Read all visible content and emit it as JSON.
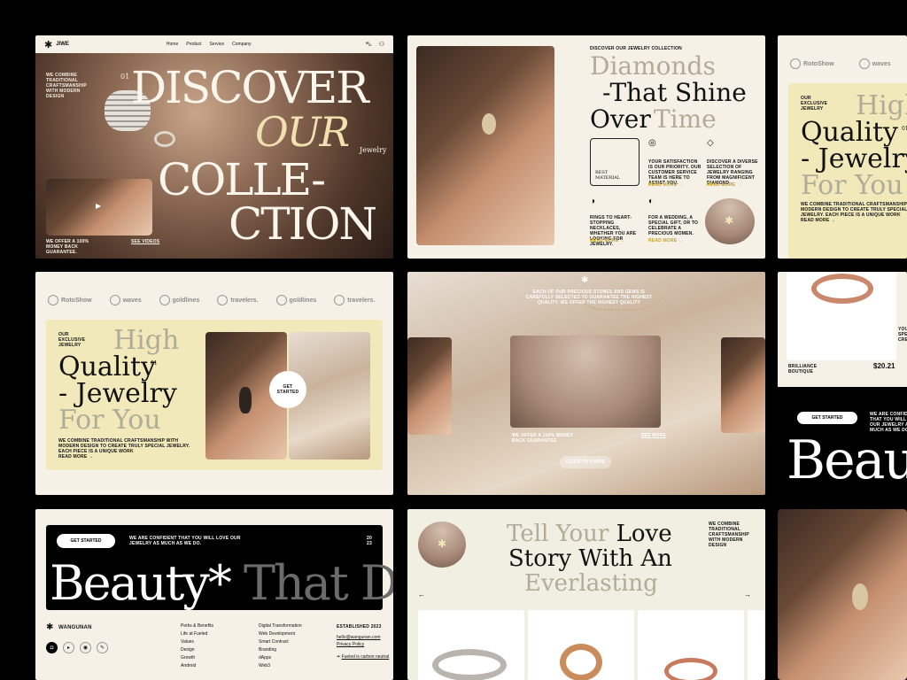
{
  "card1": {
    "brand": "JIWE",
    "nav": [
      "Home",
      "Product",
      "Service",
      "Company"
    ],
    "num": "01",
    "title_1": "DISCOVER",
    "title_2": "OUR",
    "title_3": "COLLE-",
    "title_4": "CTION",
    "subtitle": "Jewelry",
    "intro": "WE COMBINE TRADITIONAL CRAFTSMANSHIP WITH MODERN DESIGN",
    "guarantee": "WE OFFER A 100% MONEY BACK GUARANTEE.",
    "see_videos": "SEE VIDEOS"
  },
  "card2": {
    "eyebrow": "DISCOVER OUR JEWELRY COLLECTION",
    "h1": "Diamonds",
    "h2": "-That Shine",
    "h3a": "Over",
    "h3b": "Time",
    "badge": "BEST MATERIAL",
    "feat1": "YOUR SATISFACTION IS OUR PRIORITY. OUR CUSTOMER SERVICE TEAM IS HERE TO ASSIST YOU.",
    "feat2": "DISCOVER A DIVERSE SELECTION OF JEWELRY RANGING FROM MAGNIFICENT DIAMOND .",
    "feat3": "RINGS TO HEART-STOPPING NECKLACES, WHETHER YOU ARE LOOKING FOR JEWELRY.",
    "feat4": "FOR A WEDDING, A SPECIAL GIFT, OR TO CELEBRATE A PRECIOUS MOMEN.",
    "read_more": "READ MORE"
  },
  "card3": {
    "logos": [
      "RotoShow",
      "waves"
    ],
    "eyebrow": "OUR EXCLUSIVE JEWELRY",
    "h1": "High",
    "h2": "Quality",
    "num": "01",
    "h3": "- Jewelry",
    "h4": "For You",
    "body": "WE COMBINE TRADITIONAL CRAFTSMANSHIP WITH MODERN DESIGN TO CREATE TRULY SPECIAL JEWELRY. EACH PIECE IS A UNIQUE WORK",
    "read_more": "READ MORE"
  },
  "card4": {
    "logos": [
      "RotoShow",
      "waves",
      "goldlines",
      "travelers.",
      "goldlines",
      "travelers."
    ],
    "eyebrow": "OUR EXCLUSIVE JEWELRY",
    "h1": "High",
    "h2": "Quality",
    "num": "01",
    "h3": "- Jewelry",
    "h4": "For You",
    "body": "WE COMBINE TRADITIONAL CRAFTSMANSHIP WITH MODERN DESIGN TO CREATE TRULY SPECIAL JEWELRY. EACH PIECE IS A UNIQUE WORK",
    "read_more": "READ MORE",
    "cta": "GET STARTED"
  },
  "card5": {
    "caption": "EACH OF OUR PRECIOUS STONES AND GEMS IS CAREFULLY SELECTED TO GUARANTEE THE HIGHEST QUALITY. WE OFFER THE HIGHEST QUALITY",
    "guarantee": "WE OFFER A 100% MONEY BACK GUARANTEE.",
    "see_more": "SEE MORE",
    "explore": "CLICK TO SWIPE"
  },
  "card6": {
    "product": "BRILLIANCE BOUTIQUE",
    "price": "$20.21",
    "partial": "YOU SPE CRE",
    "cta": "GET STARTED",
    "note": "WE ARE CONFIDENT THAT YOU WILL LOVE OUR JEWELRY AS MUCH AS WE DO.",
    "big": "Beau"
  },
  "card7": {
    "cta": "GET STARTED",
    "note": "WE ARE CONFIDENT THAT YOU WILL LOVE OUR JEWELRY AS MUCH AS WE DO.",
    "year_1": "20",
    "year_2": "23",
    "big_1": "Beauty*",
    "big_2": "That D",
    "brand": "WANGUNAN",
    "col1": [
      "Perks & Benefits",
      "Life at Fueled",
      "Values",
      "Design",
      "Growth",
      "Android"
    ],
    "col2": [
      "Digital Transformation",
      "Web Development",
      "Smart Contract",
      "Branding",
      "dApps",
      "Web3"
    ],
    "established": "ESTABLISHED 2023",
    "email": "hello@wangunan.com",
    "privacy": "Privacy Policy",
    "carbon": "Fueled is carbon neutral"
  },
  "card8": {
    "h1a": "Tell Your",
    "h1b": "Love",
    "h2": "Story With An",
    "h3": "Everlasting",
    "intro": "WE COMBINE TRADITIONAL CRAFTSMANSHIP WITH MODERN DESIGN"
  },
  "colors": {
    "cream": "#f6f1e6",
    "yellow": "#f1e9b9",
    "gold_accent": "#c9a227",
    "background": "#000000"
  }
}
